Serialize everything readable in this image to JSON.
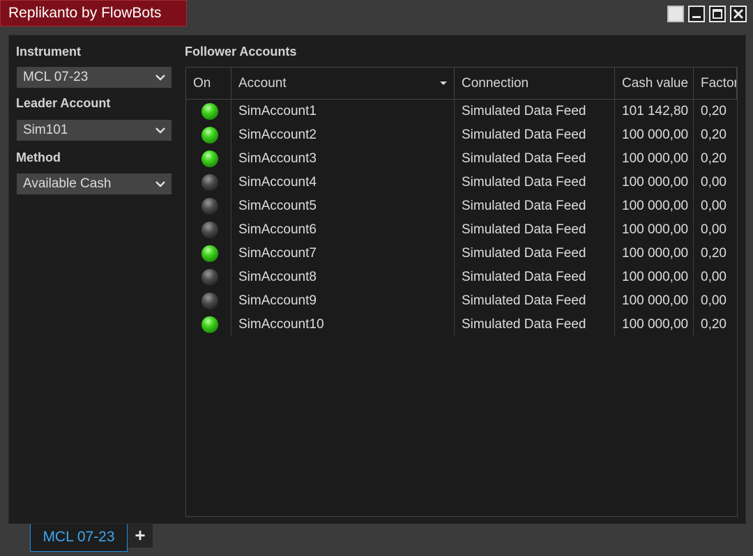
{
  "window": {
    "title": "Replikanto by FlowBots",
    "buttons": [
      "blank",
      "minimize-icon",
      "maximize-icon",
      "close-icon"
    ]
  },
  "sidebar": {
    "instrument_label": "Instrument",
    "instrument_value": "MCL 07-23",
    "leader_label": "Leader Account",
    "leader_value": "Sim101",
    "method_label": "Method",
    "method_value": "Available Cash"
  },
  "followers": {
    "title": "Follower Accounts",
    "columns": [
      "On",
      "Account",
      "Connection",
      "Cash value",
      "Factor"
    ],
    "rows": [
      {
        "on": true,
        "account": "SimAccount1",
        "connection": "Simulated Data Feed",
        "cash": "101 142,80",
        "factor": "0,20"
      },
      {
        "on": true,
        "account": "SimAccount2",
        "connection": "Simulated Data Feed",
        "cash": "100 000,00",
        "factor": "0,20"
      },
      {
        "on": true,
        "account": "SimAccount3",
        "connection": "Simulated Data Feed",
        "cash": "100 000,00",
        "factor": "0,20"
      },
      {
        "on": false,
        "account": "SimAccount4",
        "connection": "Simulated Data Feed",
        "cash": "100 000,00",
        "factor": "0,00"
      },
      {
        "on": false,
        "account": "SimAccount5",
        "connection": "Simulated Data Feed",
        "cash": "100 000,00",
        "factor": "0,00"
      },
      {
        "on": false,
        "account": "SimAccount6",
        "connection": "Simulated Data Feed",
        "cash": "100 000,00",
        "factor": "0,00"
      },
      {
        "on": true,
        "account": "SimAccount7",
        "connection": "Simulated Data Feed",
        "cash": "100 000,00",
        "factor": "0,20"
      },
      {
        "on": false,
        "account": "SimAccount8",
        "connection": "Simulated Data Feed",
        "cash": "100 000,00",
        "factor": "0,00"
      },
      {
        "on": false,
        "account": "SimAccount9",
        "connection": "Simulated Data Feed",
        "cash": "100 000,00",
        "factor": "0,00"
      },
      {
        "on": true,
        "account": "SimAccount10",
        "connection": "Simulated Data Feed",
        "cash": "100 000,00",
        "factor": "0,20"
      }
    ]
  },
  "tabs": {
    "active": "MCL 07-23",
    "add_label": "+"
  },
  "colors": {
    "title_bg": "#7d0f1a",
    "tab_accent": "#3ea6f2",
    "led_on": "#3fd11d",
    "led_off": "#4a4a4a"
  }
}
